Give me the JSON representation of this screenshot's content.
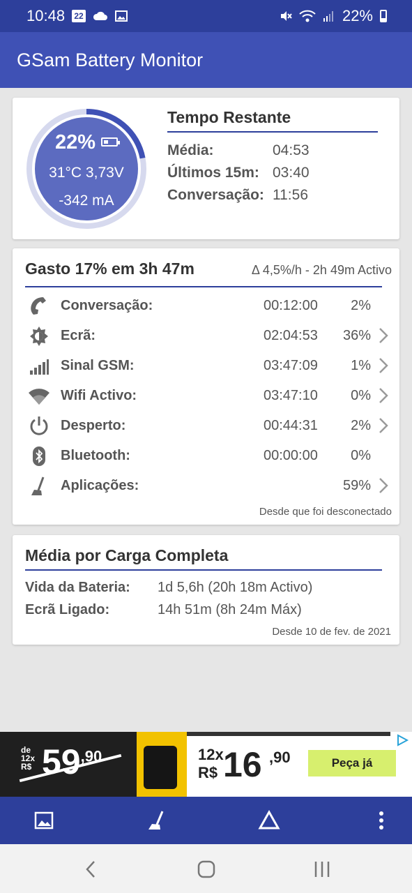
{
  "status_bar": {
    "time": "10:48",
    "calendar_day": "22",
    "battery_pct": "22%",
    "icons": [
      "calendar-icon",
      "cloud-icon",
      "image-icon",
      "mute-icon",
      "wifi-icon",
      "signal-icon",
      "battery-icon"
    ]
  },
  "app": {
    "title": "GSam Battery Monitor",
    "primary_color": "#3f51b5",
    "dark_color": "#2d3f9b"
  },
  "gauge": {
    "percent": "22%",
    "temp_voltage": "31°C  3,73V",
    "current": "-342 mA",
    "fill_fraction": 0.22
  },
  "remaining": {
    "title": "Tempo Restante",
    "rows": [
      {
        "label": "Média:",
        "value": "04:53"
      },
      {
        "label": "Últimos 15m:",
        "value": "03:40"
      },
      {
        "label": "Conversação:",
        "value": "11:56"
      }
    ]
  },
  "usage": {
    "title": "Gasto 17% em 3h 47m",
    "rate": "Δ 4,5%/h - 2h 49m Activo",
    "rows": [
      {
        "icon": "phone-icon",
        "label": "Conversação:",
        "time": "00:12:00",
        "pct": "2%",
        "chevron": false
      },
      {
        "icon": "brightness-icon",
        "label": "Ecrã:",
        "time": "02:04:53",
        "pct": "36%",
        "chevron": true
      },
      {
        "icon": "signal-bars-icon",
        "label": "Sinal GSM:",
        "time": "03:47:09",
        "pct": "1%",
        "chevron": true
      },
      {
        "icon": "wifi-icon",
        "label": "Wifi Activo:",
        "time": "03:47:10",
        "pct": "0%",
        "chevron": true
      },
      {
        "icon": "power-icon",
        "label": "Desperto:",
        "time": "00:44:31",
        "pct": "2%",
        "chevron": true
      },
      {
        "icon": "bluetooth-icon",
        "label": "Bluetooth:",
        "time": "00:00:00",
        "pct": "0%",
        "chevron": false
      },
      {
        "icon": "apps-broom-icon",
        "label": "Aplicações:",
        "time": "",
        "pct": "59%",
        "chevron": true
      }
    ],
    "footer": "Desde que foi desconectado"
  },
  "full_charge": {
    "title": "Média por Carga Completa",
    "rows": [
      {
        "label": "Vida da Bateria:",
        "value": "1d 5,6h (20h 18m Activo)"
      },
      {
        "label": "Ecrã Ligado:",
        "value": "14h 51m (8h 24m Máx)"
      }
    ],
    "footer": "Desde 10 de fev. de 2021"
  },
  "ad": {
    "old_prefix": "de 12x R$",
    "old_price": "59",
    "old_cents": ",90",
    "new_prefix_1": "12x",
    "new_prefix_2": "R$",
    "new_price": "16",
    "new_cents": ",90",
    "cta": "Peça já"
  },
  "toolbar": {
    "icons": [
      "image-icon",
      "broom-icon",
      "delta-icon",
      "more-vert-icon"
    ]
  },
  "nav": {
    "icons": [
      "back-icon",
      "home-icon",
      "recents-icon"
    ]
  }
}
